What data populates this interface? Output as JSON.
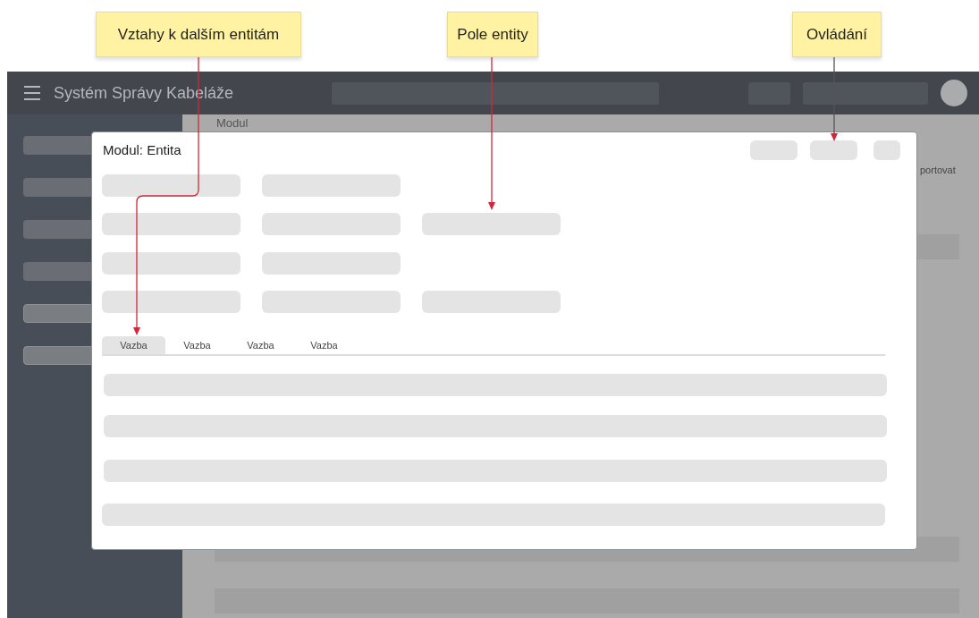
{
  "annotations": [
    {
      "label": "Vztahy k dalším entitám"
    },
    {
      "label": "Pole entity"
    },
    {
      "label": "Ovládání"
    }
  ],
  "app": {
    "title": "Systém Správy Kabeláže",
    "page_heading": "Modul",
    "toolbar_text": "portovat"
  },
  "modal": {
    "title": "Modul: Entita",
    "tabs": [
      {
        "label": "Vazba",
        "selected": true
      },
      {
        "label": "Vazba",
        "selected": false
      },
      {
        "label": "Vazba",
        "selected": false
      },
      {
        "label": "Vazba",
        "selected": false
      }
    ]
  }
}
